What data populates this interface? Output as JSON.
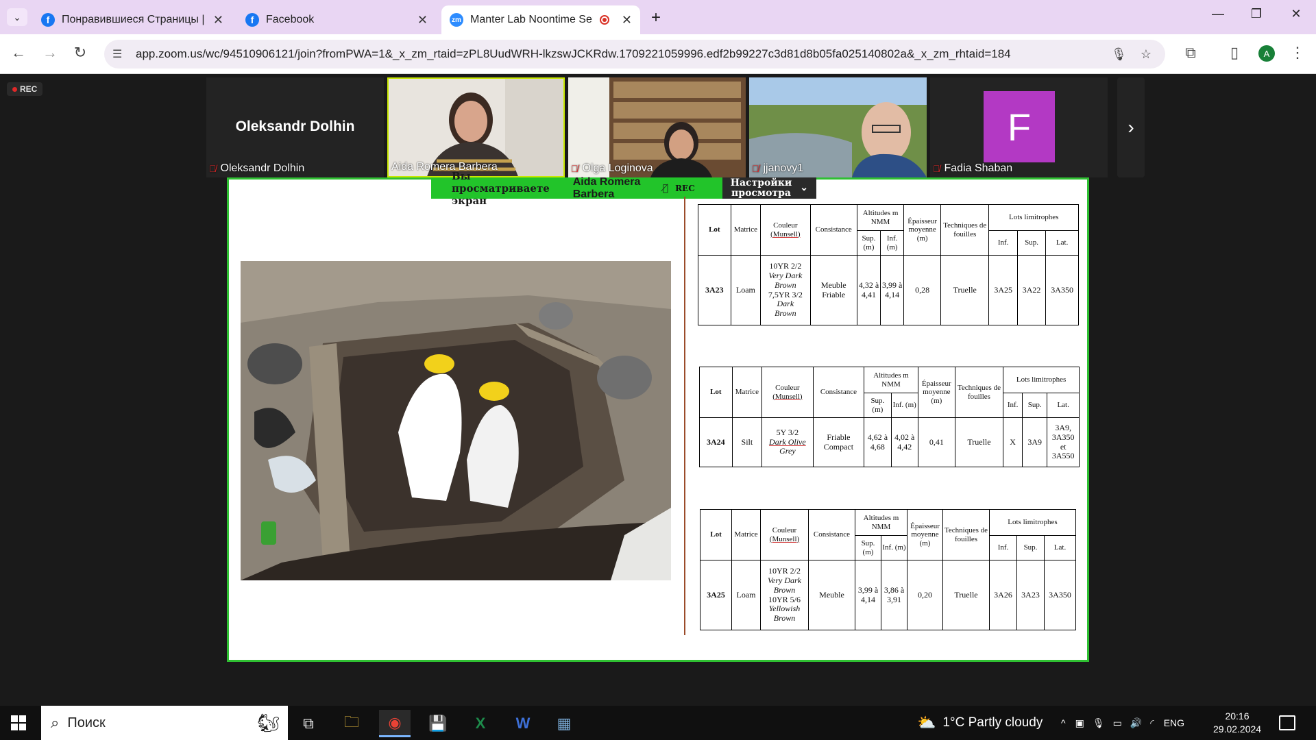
{
  "browser": {
    "tabs": [
      {
        "title": "Понравившиеся Страницы | Fa",
        "favicon": "facebook-icon",
        "active": false
      },
      {
        "title": "Facebook",
        "favicon": "facebook-icon",
        "active": false
      },
      {
        "title": "Manter Lab Noontime Semi",
        "favicon": "zoom-icon",
        "active": true,
        "recording": true
      }
    ],
    "url": "app.zoom.us/wc/94510906121/join?fromPWA=1&_x_zm_rtaid=zPL8UudWRH-lkzswJCKRdw.1709221059996.edf2b99227c3d81d8b05fa025140802a&_x_zm_rhtaid=184",
    "profile_initial": "A"
  },
  "zoom": {
    "rec_label": "REC",
    "participants": [
      {
        "name": "Oleksandr Dolhin",
        "big_name": "Oleksandr Dolhin",
        "muted": true
      },
      {
        "name": "Aida Romera Barbera",
        "muted": false,
        "speaking": true
      },
      {
        "name": "Olga Loginova",
        "muted": true
      },
      {
        "name": "jjanovy1",
        "muted": true
      },
      {
        "name": "Fadia Shaban",
        "muted": true,
        "initial": "F",
        "avatar_color": "#b339c4"
      }
    ],
    "share_banner": {
      "viewing_text": "Вы просматриваете экран",
      "presenter": "Aida Romera Barbera",
      "rec": "REC",
      "options_line1": "Настройки",
      "options_line2": "просмотра"
    }
  },
  "slide": {
    "headers": {
      "lot": "Lot",
      "matrice": "Matrice",
      "couleur": "Couleur",
      "munsell": "(Munsell)",
      "consistance": "Consistance",
      "altitudes": "Altitudes m NMM",
      "sup": "Sup. (m)",
      "inf": "Inf. (m)",
      "epaisseur": "Épaisseur moyenne (m)",
      "techniques": "Techniques de fouilles",
      "lots_limitrophes": "Lots limitrophes",
      "lim_inf": "Inf.",
      "lim_sup": "Sup.",
      "lim_lat": "Lat."
    },
    "tables": [
      {
        "lot": "3A23",
        "matrice": "Loam",
        "couleur_lines": [
          "10YR 2/2",
          "Very Dark",
          "Brown",
          "7,5YR 3/2",
          "Dark",
          "Brown"
        ],
        "consistance": "Meuble Friable",
        "sup": "4,32 à 4,41",
        "inf": "3,99 à 4,14",
        "epaisseur": "0,28",
        "techniques": "Truelle",
        "lim_inf": "3A25",
        "lim_sup": "3A22",
        "lim_lat": "3A350"
      },
      {
        "lot": "3A24",
        "matrice": "Silt",
        "couleur_lines": [
          "5Y 3/2",
          "Dark Olive",
          "Grey"
        ],
        "consistance": "Friable Compact",
        "sup": "4,62 à 4,68",
        "inf": "4,02 à 4,42",
        "epaisseur": "0,41",
        "techniques": "Truelle",
        "lim_inf": "X",
        "lim_sup": "3A9",
        "lim_lat": "3A9, 3A350 et 3A550"
      },
      {
        "lot": "3A25",
        "matrice": "Loam",
        "couleur_lines": [
          "10YR 2/2",
          "Very Dark",
          "Brown",
          "10YR 5/6",
          "Yellowish",
          "Brown"
        ],
        "consistance": "Meuble",
        "sup": "3,99 à 4,14",
        "inf": "3,86 à 3,91",
        "epaisseur": "0,20",
        "techniques": "Truelle",
        "lim_inf": "3A26",
        "lim_sup": "3A23",
        "lim_lat": "3A350"
      }
    ]
  },
  "taskbar": {
    "search_placeholder": "Поиск",
    "weather": "1°C  Partly cloudy",
    "lang": "ENG",
    "time": "20:16",
    "date": "29.02.2024"
  }
}
